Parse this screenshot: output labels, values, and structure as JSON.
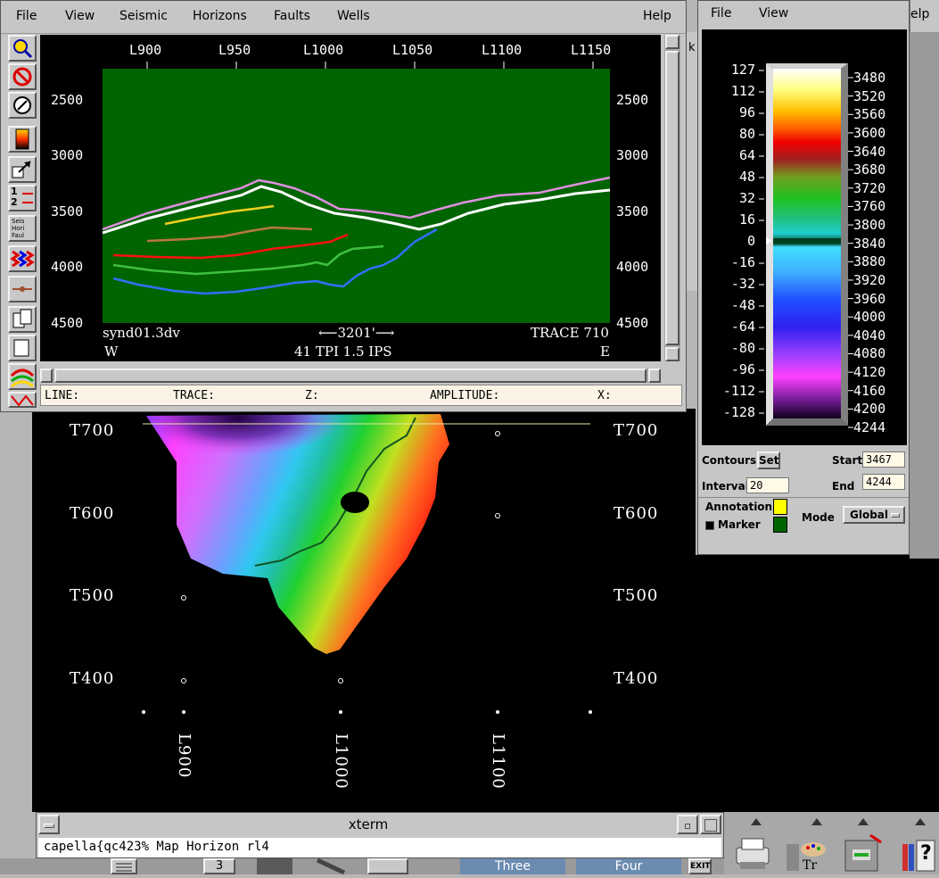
{
  "seismic_window": {
    "menu": [
      "File",
      "View",
      "Seismic",
      "Horizons",
      "Faults",
      "Wells",
      "Help"
    ],
    "top_axis": [
      "L900",
      "L950",
      "L1000",
      "L1050",
      "L1100",
      "L1150"
    ],
    "left_axis": [
      "2500",
      "3000",
      "3500",
      "4000",
      "4500"
    ],
    "right_axis": [
      "2500",
      "3000",
      "3500",
      "4000",
      "4500"
    ],
    "dataset": "synd01.3dv",
    "scale_bar": "3201'",
    "trace": "TRACE 710",
    "dir_west": "W",
    "dir_east": "E",
    "plot_scale": "41 TPI 1.5 IPS",
    "toolbar_badge": "1 2",
    "toolbar_legend": "Seis Hori Faul",
    "status": {
      "line": "LINE:",
      "trace": "TRACE:",
      "z": "Z:",
      "amplitude": "AMPLITUDE:",
      "x": "X:"
    },
    "colors": {
      "section_bg": "#006400"
    }
  },
  "colorbar_window": {
    "menu": [
      "File",
      "View"
    ],
    "left_values": [
      "127",
      "112",
      "96",
      "80",
      "64",
      "48",
      "32",
      "16",
      "0",
      "-16",
      "-32",
      "-48",
      "-64",
      "-80",
      "-96",
      "-112",
      "-128"
    ],
    "right_values": [
      "3480",
      "3520",
      "3560",
      "3600",
      "3640",
      "3680",
      "3720",
      "3760",
      "3800",
      "3840",
      "3880",
      "3920",
      "3960",
      "4000",
      "4040",
      "4080",
      "4120",
      "4160",
      "4200",
      "4244"
    ],
    "contours_label": "Contours:",
    "set_button": "Set",
    "start_label": "Start",
    "start_value": "3467",
    "interval_label": "Interval",
    "interval_value": "20",
    "end_label": "End",
    "end_value": "4244",
    "annotation_label": "Annotation",
    "marker_label": "Marker",
    "mode_label": "Mode",
    "mode_value": "Global",
    "colors": {
      "annotation": "#ffff00",
      "marker": "#006400"
    }
  },
  "map_view": {
    "left_labels": [
      "T700",
      "T600",
      "T500",
      "T400"
    ],
    "right_labels": [
      "T700",
      "T600",
      "T500",
      "T400"
    ],
    "bottom_labels": [
      "L900",
      "L1000",
      "L1100"
    ]
  },
  "background_fragments": {
    "help_partial": "elp",
    "k_partial": "k"
  },
  "xterm": {
    "title": "xterm",
    "prompt": "capella{qc423% Map Horizon rl4"
  },
  "panel": {
    "workspaces": [
      "3",
      "Three",
      "Four"
    ],
    "exit_label": "EXIT",
    "help_label": "?"
  }
}
